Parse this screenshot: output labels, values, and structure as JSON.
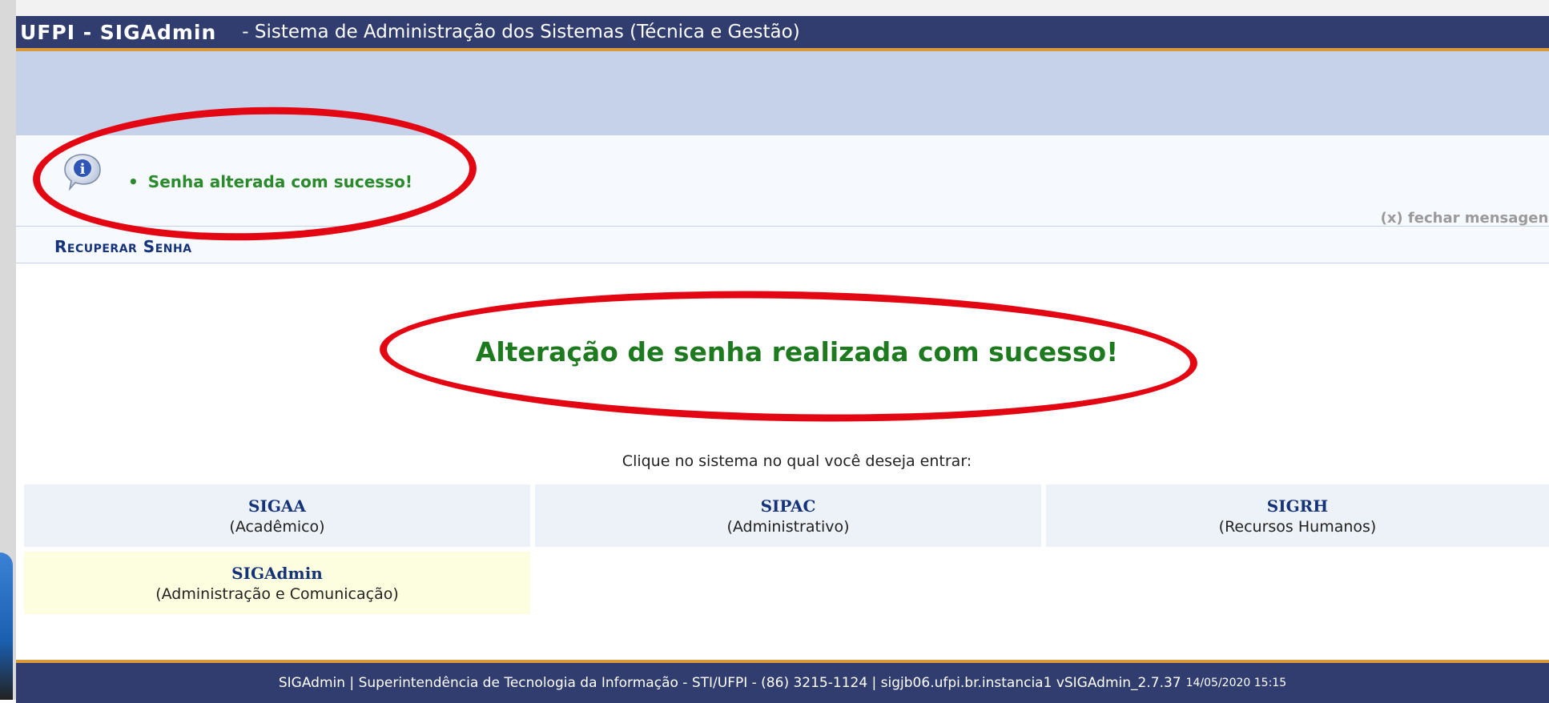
{
  "header": {
    "app_name": "UFPI - SIGAdmin",
    "subtitle": "- Sistema de Administração dos Sistemas (Técnica e Gestão)"
  },
  "message": {
    "icon": "info-icon",
    "bullet": "•",
    "text": "Senha alterada com sucesso!",
    "close_label": "(x) fechar mensagens"
  },
  "section": {
    "title": "Recuperar Senha"
  },
  "main": {
    "success_text": "Alteração de senha realizada com sucesso!",
    "prompt": "Clique no sistema no qual você deseja entrar:"
  },
  "systems": [
    {
      "name": "SIGAA",
      "desc": "(Acadêmico)"
    },
    {
      "name": "SIPAC",
      "desc": "(Administrativo)"
    },
    {
      "name": "SIGRH",
      "desc": "(Recursos Humanos)"
    },
    {
      "name": "SIGAdmin",
      "desc": "(Administração e Comunicação)"
    }
  ],
  "footer": {
    "text": "SIGAdmin | Superintendência de Tecnologia da Informação - STI/UFPI - (86) 3215-1124 | sigjb06.ufpi.br.instancia1 vSIGAdmin_2.7.37",
    "timestamp": "14/05/2020 15:15"
  },
  "colors": {
    "header_bg": "#303d6e",
    "accent_orange": "#d99a3a",
    "banner_bg": "#c5d2ea",
    "success_green": "#1e7a1e",
    "highlight_red": "#e30613"
  }
}
